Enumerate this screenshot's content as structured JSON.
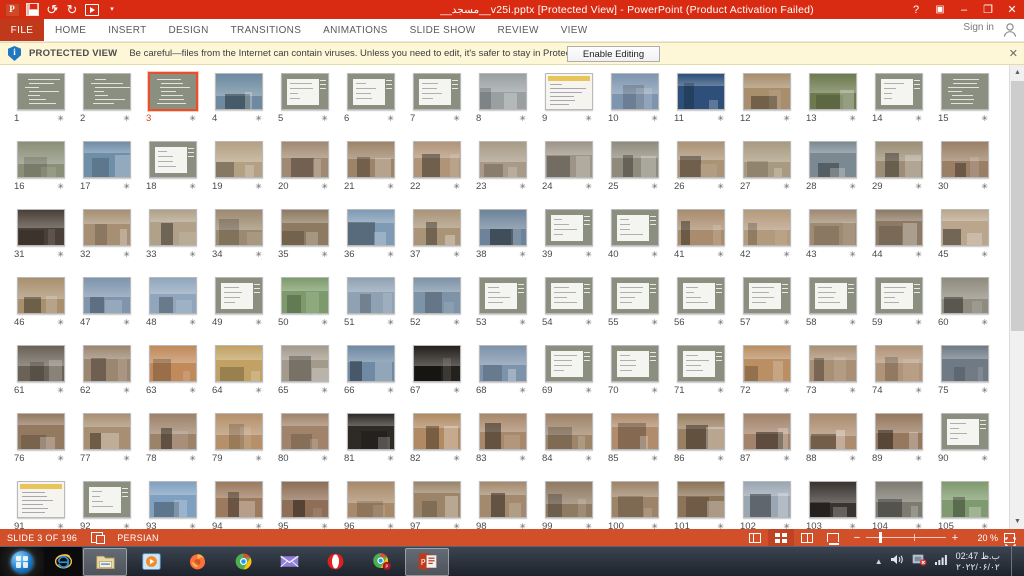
{
  "window": {
    "title": "__مسجد__v25i.pptx [Protected View] -  PowerPoint (Product Activation Failed)",
    "help_label": "?",
    "ribbon_display_label": "▣",
    "minimize_label": "–",
    "restore_label": "❐",
    "close_label": "✕",
    "accent_color": "#d92b12",
    "file_tab_color": "#c0391b"
  },
  "quick_access": {
    "items": [
      {
        "name": "powerpoint-logo",
        "label": "P"
      },
      {
        "name": "save-icon",
        "label": ""
      },
      {
        "name": "undo-icon",
        "label": "↺"
      },
      {
        "name": "redo-icon",
        "label": "↻"
      },
      {
        "name": "start-slideshow-icon",
        "label": ""
      },
      {
        "name": "customize-qat-icon",
        "label": "▾"
      }
    ]
  },
  "ribbon": {
    "file_tab": "FILE",
    "tabs": [
      {
        "label": "HOME"
      },
      {
        "label": "INSERT"
      },
      {
        "label": "DESIGN"
      },
      {
        "label": "TRANSITIONS"
      },
      {
        "label": "ANIMATIONS"
      },
      {
        "label": "SLIDE SHOW"
      },
      {
        "label": "REVIEW"
      },
      {
        "label": "VIEW"
      }
    ],
    "sign_in": "Sign in"
  },
  "protected_view": {
    "label": "PROTECTED VIEW",
    "message": "Be careful—files from the Internet can contain viruses. Unless you need to edit, it's safer to stay in Protected View.",
    "button": "Enable Editing",
    "close": "✕",
    "bar_color": "#fdf7d8"
  },
  "status_bar": {
    "slide_indicator": "SLIDE 3 OF 196",
    "notes_icon": "notes-icon",
    "language": "PERSIAN",
    "zoom_percent": "20 %",
    "zoom_minus": "−",
    "zoom_plus": "+",
    "views": [
      {
        "name": "view-normal",
        "label": "Normal"
      },
      {
        "name": "view-slide-sorter",
        "label": "Slide Sorter",
        "active": true
      },
      {
        "name": "view-reading",
        "label": "Reading View"
      },
      {
        "name": "view-slideshow",
        "label": "Slide Show"
      }
    ],
    "fit_label": "Fit slide to current window"
  },
  "taskbar": {
    "start_label": "Start",
    "items": [
      {
        "name": "taskbar-internet-explorer",
        "label": "Internet Explorer"
      },
      {
        "name": "taskbar-file-explorer",
        "label": "File Explorer",
        "active": true
      },
      {
        "name": "taskbar-media-player",
        "label": "Windows Media Player"
      },
      {
        "name": "taskbar-firefox",
        "label": "Mozilla Firefox"
      },
      {
        "name": "taskbar-chrome",
        "label": "Google Chrome"
      },
      {
        "name": "taskbar-mail",
        "label": "Mail"
      },
      {
        "name": "taskbar-opera",
        "label": "Opera"
      },
      {
        "name": "taskbar-chrome-canary",
        "label": "Chrome"
      },
      {
        "name": "taskbar-powerpoint",
        "label": "PowerPoint",
        "active": true
      }
    ],
    "tray": {
      "volume": "volume-icon",
      "network": "network-icon",
      "signal": "signal-icon",
      "time": "02:47 ب.ظ",
      "date": "۲۰۲۲/۰۶/۰۲"
    }
  },
  "slide_sorter": {
    "selected_slide": 3,
    "columns": 15,
    "star_glyph": "✳",
    "slides": [
      {
        "n": 1,
        "k": "text"
      },
      {
        "n": 2,
        "k": "text"
      },
      {
        "n": 3,
        "k": "text"
      },
      {
        "n": 4,
        "k": "photo",
        "c": "#6d8aa0"
      },
      {
        "n": 5,
        "k": "doc"
      },
      {
        "n": 6,
        "k": "doc"
      },
      {
        "n": 7,
        "k": "doc"
      },
      {
        "n": 8,
        "k": "photo",
        "c": "#9aa0a2"
      },
      {
        "n": 9,
        "k": "doc2"
      },
      {
        "n": 10,
        "k": "photo",
        "c": "#7e95b0"
      },
      {
        "n": 11,
        "k": "photo",
        "c": "#2d4f79"
      },
      {
        "n": 12,
        "k": "photo",
        "c": "#a88e6c"
      },
      {
        "n": 13,
        "k": "photo",
        "c": "#6d7a4e"
      },
      {
        "n": 14,
        "k": "doc"
      },
      {
        "n": 15,
        "k": "text"
      },
      {
        "n": 16,
        "k": "photo",
        "c": "#8a8f78"
      },
      {
        "n": 17,
        "k": "photo",
        "c": "#6f8ea8"
      },
      {
        "n": 18,
        "k": "doc"
      },
      {
        "n": 19,
        "k": "photo",
        "c": "#b4a184"
      },
      {
        "n": 20,
        "k": "photo",
        "c": "#a08972"
      },
      {
        "n": 21,
        "k": "photo",
        "c": "#9c8468"
      },
      {
        "n": 22,
        "k": "photo",
        "c": "#b09478"
      },
      {
        "n": 23,
        "k": "photo",
        "c": "#a89a86"
      },
      {
        "n": 24,
        "k": "photo",
        "c": "#9d9486"
      },
      {
        "n": 25,
        "k": "photo",
        "c": "#8f8b7c"
      },
      {
        "n": 26,
        "k": "photo",
        "c": "#ab9376"
      },
      {
        "n": 27,
        "k": "photo",
        "c": "#a89a80"
      },
      {
        "n": 28,
        "k": "photo",
        "c": "#7b8a92"
      },
      {
        "n": 29,
        "k": "photo",
        "c": "#9c8e76"
      },
      {
        "n": 30,
        "k": "photo",
        "c": "#9a7f66"
      },
      {
        "n": 31,
        "k": "photo",
        "c": "#4a4038"
      },
      {
        "n": 32,
        "k": "photo",
        "c": "#a68f72"
      },
      {
        "n": 33,
        "k": "photo",
        "c": "#b0a188"
      },
      {
        "n": 34,
        "k": "photo",
        "c": "#9c8a70"
      },
      {
        "n": 35,
        "k": "photo",
        "c": "#8d7a60"
      },
      {
        "n": 36,
        "k": "photo",
        "c": "#7e9ab4"
      },
      {
        "n": 37,
        "k": "photo",
        "c": "#a99478"
      },
      {
        "n": 38,
        "k": "photo",
        "c": "#6d8399"
      },
      {
        "n": 39,
        "k": "doc"
      },
      {
        "n": 40,
        "k": "doc"
      },
      {
        "n": 41,
        "k": "photo",
        "c": "#a98c6e"
      },
      {
        "n": 42,
        "k": "photo",
        "c": "#b39a7c"
      },
      {
        "n": 43,
        "k": "photo",
        "c": "#9f8a72"
      },
      {
        "n": 44,
        "k": "photo",
        "c": "#8c7a64"
      },
      {
        "n": 45,
        "k": "photo",
        "c": "#b9a68c"
      },
      {
        "n": 46,
        "k": "photo",
        "c": "#a8906e"
      },
      {
        "n": 47,
        "k": "photo",
        "c": "#7e95ad"
      },
      {
        "n": 48,
        "k": "photo",
        "c": "#8fa6bd"
      },
      {
        "n": 49,
        "k": "doc"
      },
      {
        "n": 50,
        "k": "photo",
        "c": "#7d9b6a"
      },
      {
        "n": 51,
        "k": "photo",
        "c": "#8fa2b4"
      },
      {
        "n": 52,
        "k": "photo",
        "c": "#7d93a8"
      },
      {
        "n": 53,
        "k": "doc"
      },
      {
        "n": 54,
        "k": "doc"
      },
      {
        "n": 55,
        "k": "doc"
      },
      {
        "n": 56,
        "k": "doc"
      },
      {
        "n": 57,
        "k": "doc"
      },
      {
        "n": 58,
        "k": "doc"
      },
      {
        "n": 59,
        "k": "doc"
      },
      {
        "n": 60,
        "k": "photo",
        "c": "#8f8b7e"
      },
      {
        "n": 61,
        "k": "photo",
        "c": "#6a6257"
      },
      {
        "n": 62,
        "k": "photo",
        "c": "#9b8670"
      },
      {
        "n": 63,
        "k": "photo",
        "c": "#c08a5a"
      },
      {
        "n": 64,
        "k": "photo",
        "c": "#c2a264"
      },
      {
        "n": 65,
        "k": "photo",
        "c": "#a39a8c"
      },
      {
        "n": 66,
        "k": "photo",
        "c": "#6f8aa4"
      },
      {
        "n": 67,
        "k": "photo",
        "c": "#24201c"
      },
      {
        "n": 68,
        "k": "photo",
        "c": "#7d93ab"
      },
      {
        "n": 69,
        "k": "doc"
      },
      {
        "n": 70,
        "k": "doc"
      },
      {
        "n": 71,
        "k": "doc"
      },
      {
        "n": 72,
        "k": "photo",
        "c": "#b98f63"
      },
      {
        "n": 73,
        "k": "photo",
        "c": "#a98f73"
      },
      {
        "n": 74,
        "k": "photo",
        "c": "#b09478"
      },
      {
        "n": 75,
        "k": "photo",
        "c": "#6e7a86"
      },
      {
        "n": 76,
        "k": "photo",
        "c": "#93795f"
      },
      {
        "n": 77,
        "k": "photo",
        "c": "#a88f71"
      },
      {
        "n": 78,
        "k": "photo",
        "c": "#9d826a"
      },
      {
        "n": 79,
        "k": "photo",
        "c": "#b5906a"
      },
      {
        "n": 80,
        "k": "photo",
        "c": "#a0836a"
      },
      {
        "n": 81,
        "k": "photo",
        "c": "#2e2a26"
      },
      {
        "n": 82,
        "k": "photo",
        "c": "#b08a62"
      },
      {
        "n": 83,
        "k": "photo",
        "c": "#a8886a"
      },
      {
        "n": 84,
        "k": "photo",
        "c": "#9e8468"
      },
      {
        "n": 85,
        "k": "photo",
        "c": "#b08c6c"
      },
      {
        "n": 86,
        "k": "photo",
        "c": "#9a8062"
      },
      {
        "n": 87,
        "k": "photo",
        "c": "#a3836a"
      },
      {
        "n": 88,
        "k": "photo",
        "c": "#ab8c6e"
      },
      {
        "n": 89,
        "k": "photo",
        "c": "#96785e"
      },
      {
        "n": 90,
        "k": "doc"
      },
      {
        "n": 91,
        "k": "doc2"
      },
      {
        "n": 92,
        "k": "doc"
      },
      {
        "n": 93,
        "k": "photo",
        "c": "#7fa0c0"
      },
      {
        "n": 94,
        "k": "photo",
        "c": "#9b7a5e"
      },
      {
        "n": 95,
        "k": "photo",
        "c": "#8e6e56"
      },
      {
        "n": 96,
        "k": "photo",
        "c": "#a88a6a"
      },
      {
        "n": 97,
        "k": "photo",
        "c": "#9b8468"
      },
      {
        "n": 98,
        "k": "photo",
        "c": "#a38a6e"
      },
      {
        "n": 99,
        "k": "photo",
        "c": "#8f7a62"
      },
      {
        "n": 100,
        "k": "photo",
        "c": "#9d8468"
      },
      {
        "n": 101,
        "k": "photo",
        "c": "#8c7458"
      },
      {
        "n": 102,
        "k": "photo",
        "c": "#9aa6b2"
      },
      {
        "n": 103,
        "k": "photo",
        "c": "#3a3430"
      },
      {
        "n": 104,
        "k": "photo",
        "c": "#7d7a70"
      },
      {
        "n": 105,
        "k": "photo",
        "c": "#7f9a6e"
      }
    ]
  }
}
